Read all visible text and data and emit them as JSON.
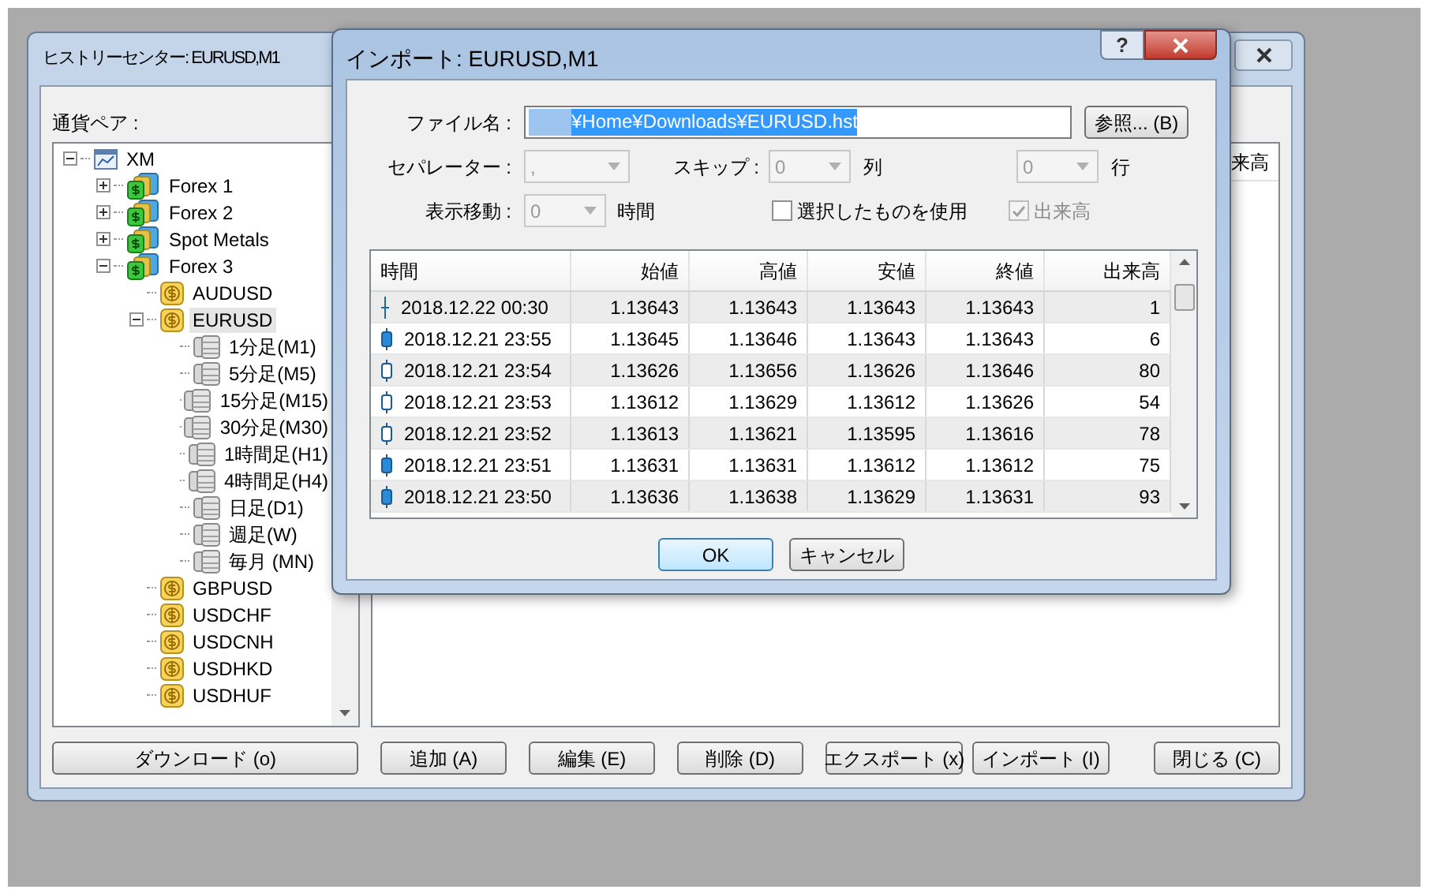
{
  "history_window": {
    "title": "ヒストリーセンター: EURUSD,M1",
    "tree_label": "通貨ペア :",
    "tree": [
      {
        "label": "XM",
        "kind": "root",
        "expanded": true,
        "selected": false,
        "children": [
          {
            "label": "Forex 1",
            "kind": "group",
            "expanded": false,
            "selected": false
          },
          {
            "label": "Forex 2",
            "kind": "group",
            "expanded": false,
            "selected": false
          },
          {
            "label": "Spot Metals",
            "kind": "group",
            "expanded": false,
            "selected": false
          },
          {
            "label": "Forex 3",
            "kind": "group",
            "expanded": true,
            "selected": false,
            "children": [
              {
                "label": "AUDUSD",
                "kind": "symbol",
                "selected": false
              },
              {
                "label": "EURUSD",
                "kind": "symbol",
                "expanded": true,
                "selected": true,
                "children": [
                  {
                    "label": "1分足(M1)",
                    "kind": "period",
                    "selected": false
                  },
                  {
                    "label": "5分足(M5)",
                    "kind": "period",
                    "selected": false
                  },
                  {
                    "label": "15分足(M15)",
                    "kind": "period",
                    "selected": false
                  },
                  {
                    "label": "30分足(M30)",
                    "kind": "period",
                    "selected": false
                  },
                  {
                    "label": "1時間足(H1)",
                    "kind": "period",
                    "selected": false
                  },
                  {
                    "label": "4時間足(H4)",
                    "kind": "period",
                    "selected": false
                  },
                  {
                    "label": "日足(D1)",
                    "kind": "period",
                    "selected": false
                  },
                  {
                    "label": "週足(W)",
                    "kind": "period",
                    "selected": false
                  },
                  {
                    "label": "毎月 (MN)",
                    "kind": "period",
                    "selected": false
                  }
                ]
              },
              {
                "label": "GBPUSD",
                "kind": "symbol",
                "selected": false
              },
              {
                "label": "USDCHF",
                "kind": "symbol",
                "selected": false
              },
              {
                "label": "USDCNH",
                "kind": "symbol",
                "selected": false
              },
              {
                "label": "USDHKD",
                "kind": "symbol",
                "selected": false
              },
              {
                "label": "USDHUF",
                "kind": "symbol",
                "selected": false
              }
            ]
          }
        ]
      }
    ],
    "list_panel": {
      "column_header": "来高"
    },
    "buttons": [
      {
        "label": "ダウンロード (o)",
        "kind": "wide"
      },
      {
        "label": "追加 (A)",
        "kind": "normal"
      },
      {
        "label": "編集 (E)",
        "kind": "normal"
      },
      {
        "label": "削除 (D)",
        "kind": "normal"
      },
      {
        "label": "エクスポート (x)",
        "kind": "normal"
      },
      {
        "label": "インポート (I)",
        "kind": "normal"
      },
      {
        "label": "閉じる (C)",
        "kind": "right"
      }
    ]
  },
  "import_dialog": {
    "title": "インポート: EURUSD,M1",
    "help_button": "?",
    "file_label": "ファイル名 :",
    "file_value": "¥Home¥Downloads¥EURUSD.hst",
    "browse_button": "参照... (B)",
    "separator": {
      "label": "セパレーター :",
      "value": ",",
      "disabled": true
    },
    "skip": {
      "label": "スキップ :",
      "value": "0",
      "unit": "列",
      "disabled": true
    },
    "skip_rows": {
      "value": "0",
      "unit": "行",
      "disabled": true
    },
    "shift": {
      "label": "表示移動 :",
      "value": "0",
      "unit": "時間",
      "disabled": true
    },
    "checkboxes": [
      {
        "label": "選択したものを使用",
        "checked": false,
        "disabled": false
      },
      {
        "label": "出来高",
        "checked": true,
        "disabled": true
      }
    ],
    "table": {
      "columns": [
        "時間",
        "始値",
        "高値",
        "安値",
        "終値",
        "出来高"
      ],
      "rows": [
        {
          "kind": "doji",
          "cells": [
            "2018.12.22 00:30",
            "1.13643",
            "1.13643",
            "1.13643",
            "1.13643",
            "1"
          ]
        },
        {
          "kind": "filled",
          "cells": [
            "2018.12.21 23:55",
            "1.13645",
            "1.13646",
            "1.13643",
            "1.13643",
            "6"
          ]
        },
        {
          "kind": "hollow",
          "cells": [
            "2018.12.21 23:54",
            "1.13626",
            "1.13656",
            "1.13626",
            "1.13646",
            "80"
          ]
        },
        {
          "kind": "hollow",
          "cells": [
            "2018.12.21 23:53",
            "1.13612",
            "1.13629",
            "1.13612",
            "1.13626",
            "54"
          ]
        },
        {
          "kind": "hollow",
          "cells": [
            "2018.12.21 23:52",
            "1.13613",
            "1.13621",
            "1.13595",
            "1.13616",
            "78"
          ]
        },
        {
          "kind": "filled",
          "cells": [
            "2018.12.21 23:51",
            "1.13631",
            "1.13631",
            "1.13612",
            "1.13612",
            "75"
          ]
        },
        {
          "kind": "filled",
          "cells": [
            "2018.12.21 23:50",
            "1.13636",
            "1.13638",
            "1.13629",
            "1.13631",
            "93"
          ]
        }
      ]
    },
    "buttons": [
      {
        "label": "OK",
        "kind": "default"
      },
      {
        "label": "キャンセル",
        "kind": "normal"
      }
    ]
  }
}
